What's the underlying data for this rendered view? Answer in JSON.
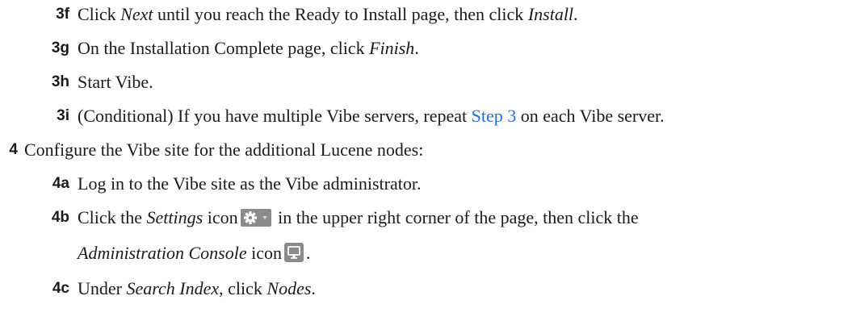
{
  "steps": {
    "3f": {
      "num": "3f",
      "t1": "Click ",
      "i1": "Next",
      "t2": " until you reach the Ready to Install page, then click ",
      "i2": "Install",
      "t3": "."
    },
    "3g": {
      "num": "3g",
      "t1": "On the Installation Complete page, click ",
      "i1": "Finish",
      "t2": "."
    },
    "3h": {
      "num": "3h",
      "t1": "Start Vibe."
    },
    "3i": {
      "num": "3i",
      "t1": "(Conditional) If you have multiple Vibe servers, repeat ",
      "link": "Step 3",
      "t2": " on each Vibe server."
    },
    "4": {
      "num": "4",
      "t1": "Configure the Vibe site for the additional Lucene nodes:"
    },
    "4a": {
      "num": "4a",
      "t1": "Log in to the Vibe site as the Vibe administrator."
    },
    "4b": {
      "num": "4b",
      "t1": "Click the ",
      "i1": "Settings",
      "t2": " icon",
      "t3": " in the upper right corner of the page, then click the",
      "cont_i1": "Administration Console",
      "cont_t1": " icon",
      "cont_t2": "."
    },
    "4c": {
      "num": "4c",
      "t1": "Under ",
      "i1": "Search Index",
      "t2": ", click ",
      "i2": "Nodes",
      "t3": "."
    }
  },
  "icons": {
    "settings": "gear-dropdown-icon",
    "admin_console": "monitor-icon"
  },
  "colors": {
    "link": "#2a6ed0",
    "text": "#1a1a1a"
  }
}
